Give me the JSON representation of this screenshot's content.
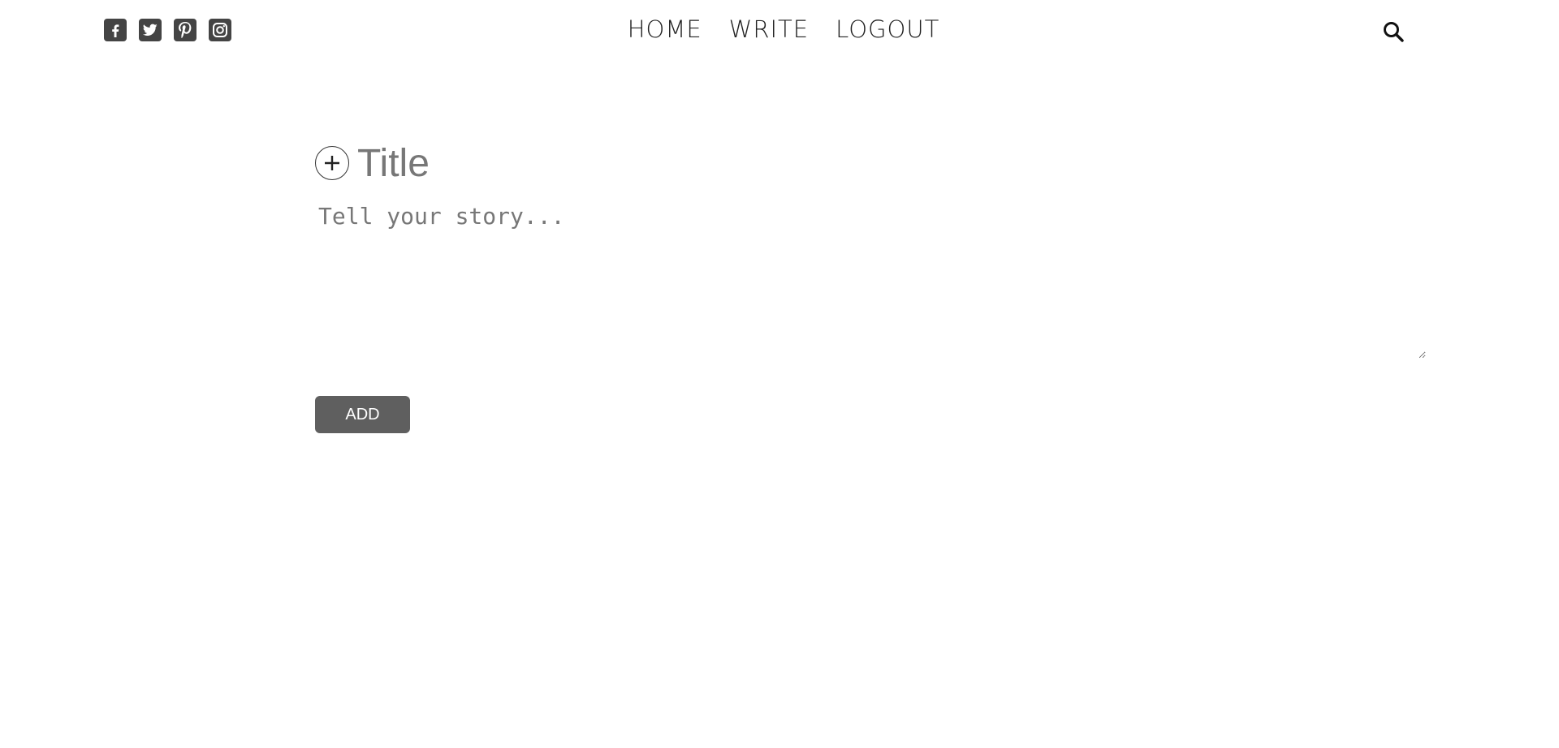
{
  "nav": {
    "social": [
      {
        "name": "facebook-icon"
      },
      {
        "name": "twitter-icon"
      },
      {
        "name": "pinterest-icon"
      },
      {
        "name": "instagram-icon"
      }
    ],
    "links": [
      "HOME",
      "WRITE",
      "LOGOUT"
    ],
    "search_icon": "search-icon"
  },
  "write": {
    "title_placeholder": "Title",
    "story_placeholder": "Tell your story...",
    "add_icon": "plus-circle-icon",
    "submit_label": "ADD"
  },
  "colors": {
    "icon_fill": "#444444",
    "button_bg": "#5f5f5f",
    "placeholder": "#777777"
  }
}
